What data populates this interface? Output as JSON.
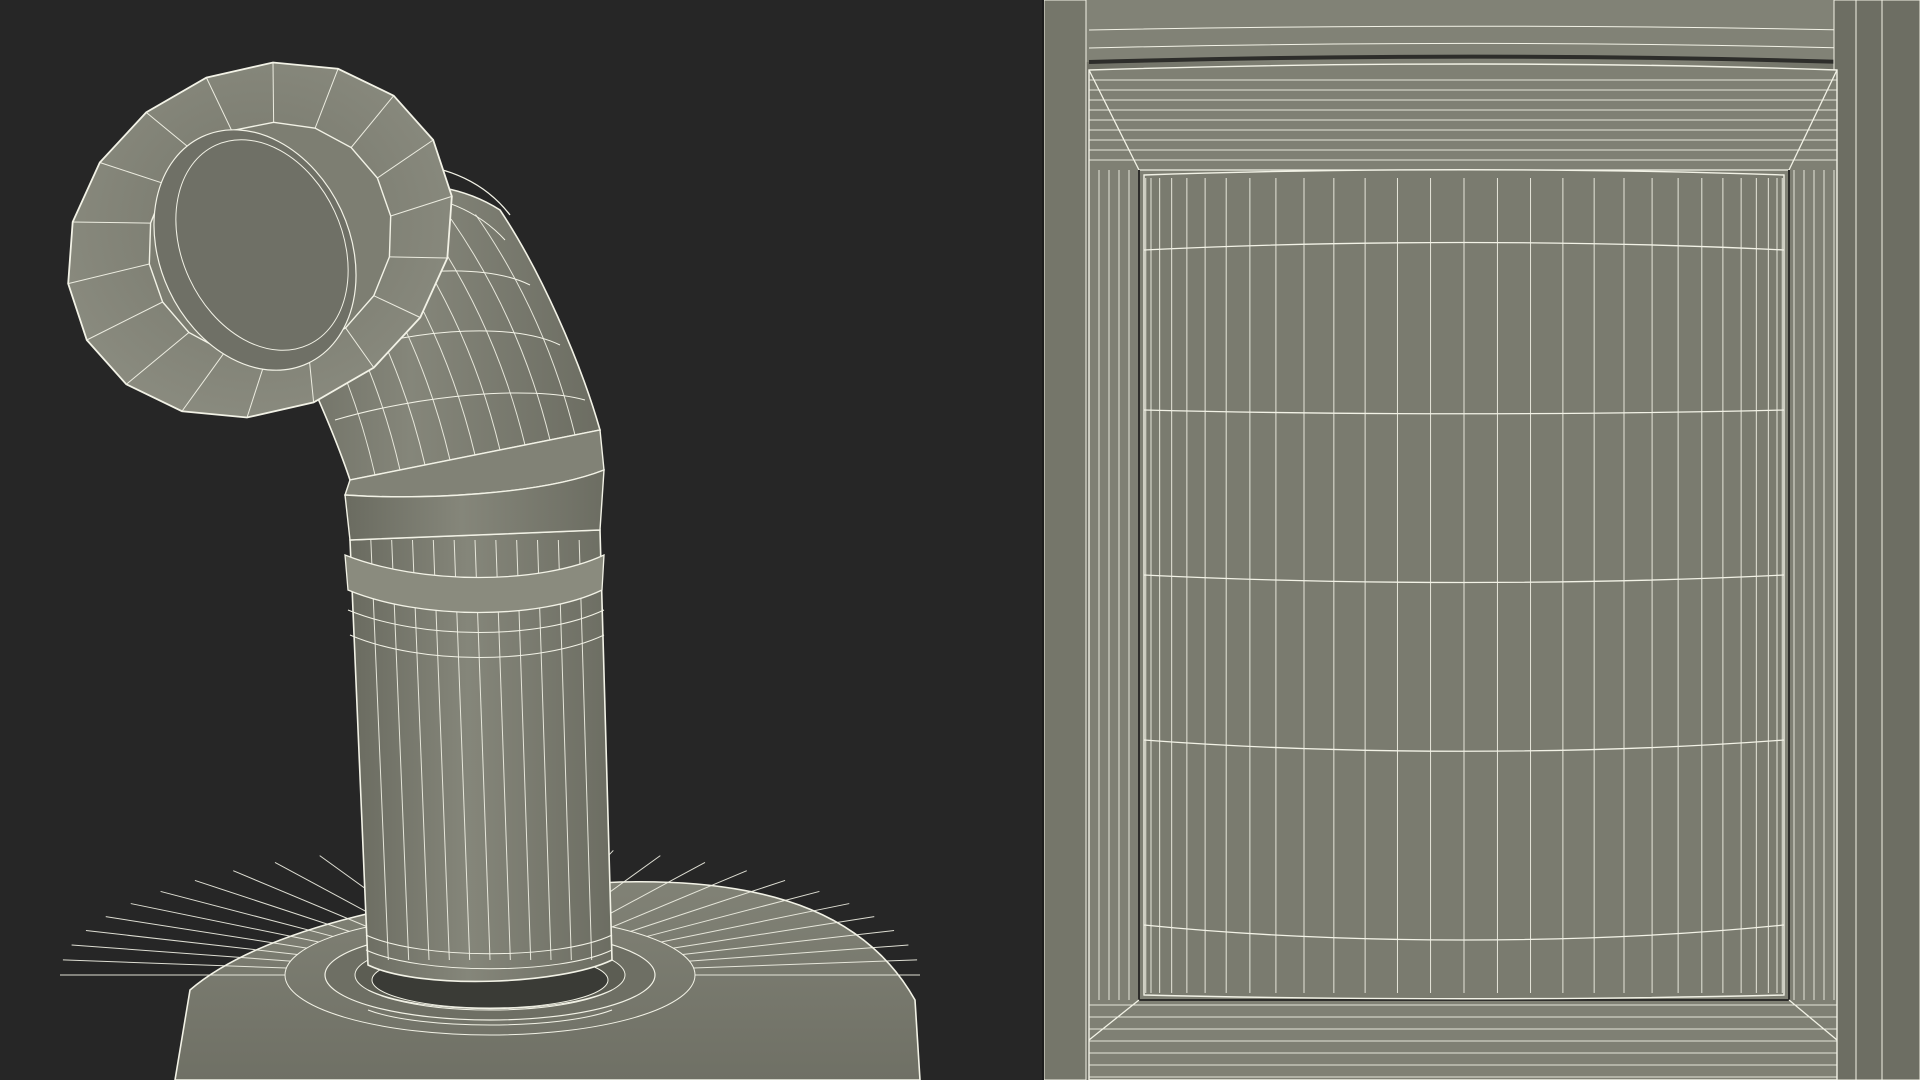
{
  "image": {
    "description_type": "3d-wireframe-render",
    "panels": [
      {
        "id": "left",
        "subject": "stove-chimney-pipe-elbow-wireframe"
      },
      {
        "id": "right",
        "subject": "stove-door-panel-wireframe"
      }
    ]
  },
  "colors": {
    "background": "#262626",
    "mesh_fill": "#7c7d70",
    "mesh_fill_light": "#8a8b7e",
    "mesh_fill_dark": "#5f6055",
    "wire": "#f2f2e6",
    "crease": "#2d2d2a"
  }
}
